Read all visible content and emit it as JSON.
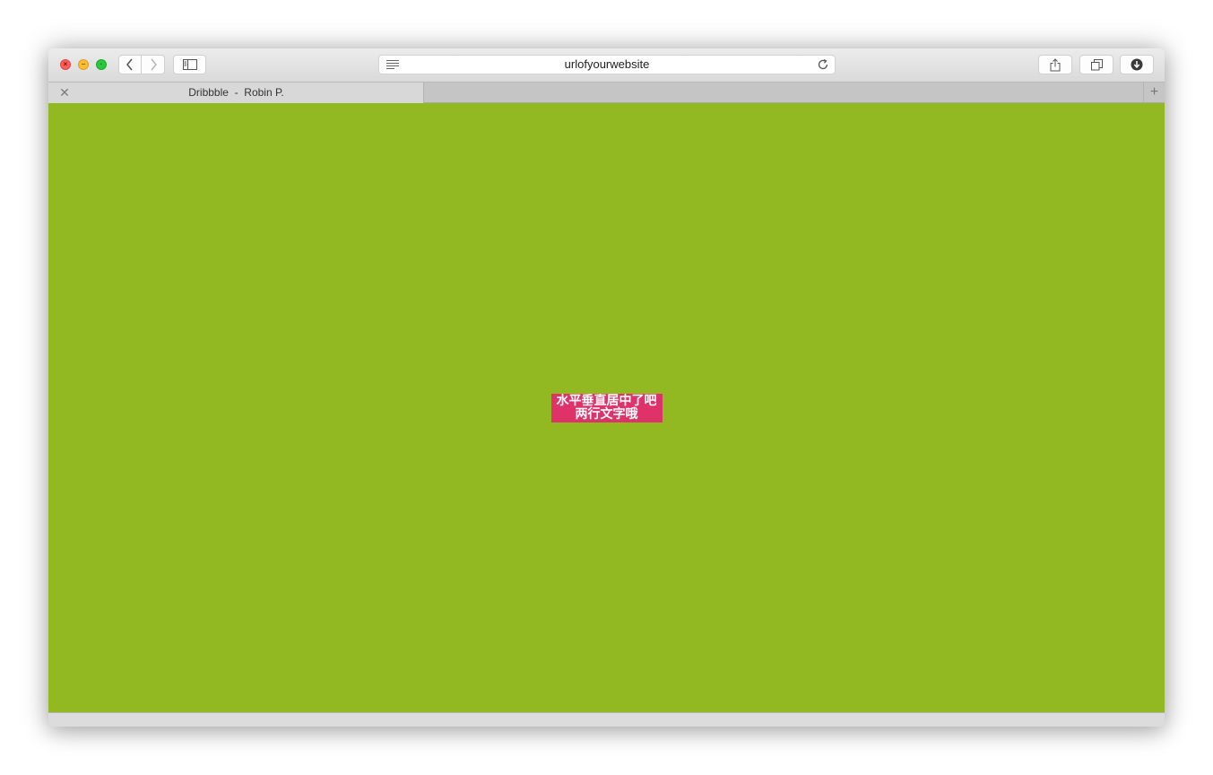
{
  "browser": {
    "url": "urlofyourwebsite",
    "tab_title": "Dribbble  -  Robin P."
  },
  "icons": {
    "close": "close-dot-icon",
    "minimize": "minimize-dot-icon",
    "zoom": "fullscreen-dot-icon",
    "back": "chevron-left-icon",
    "forward": "chevron-right-icon",
    "sidebar": "sidebar-icon",
    "reader": "reader-icon",
    "reload": "reload-icon",
    "share": "share-icon",
    "tabs": "tab-overview-icon",
    "download": "download-icon",
    "tab_close": "close-icon",
    "new_tab": "plus-icon"
  },
  "page": {
    "line1": "水平垂直居中了吧",
    "line2": "两行文字哦"
  },
  "colors": {
    "page_background": "#92b822",
    "box_background": "#e0326a",
    "box_text": "#ffffff"
  }
}
